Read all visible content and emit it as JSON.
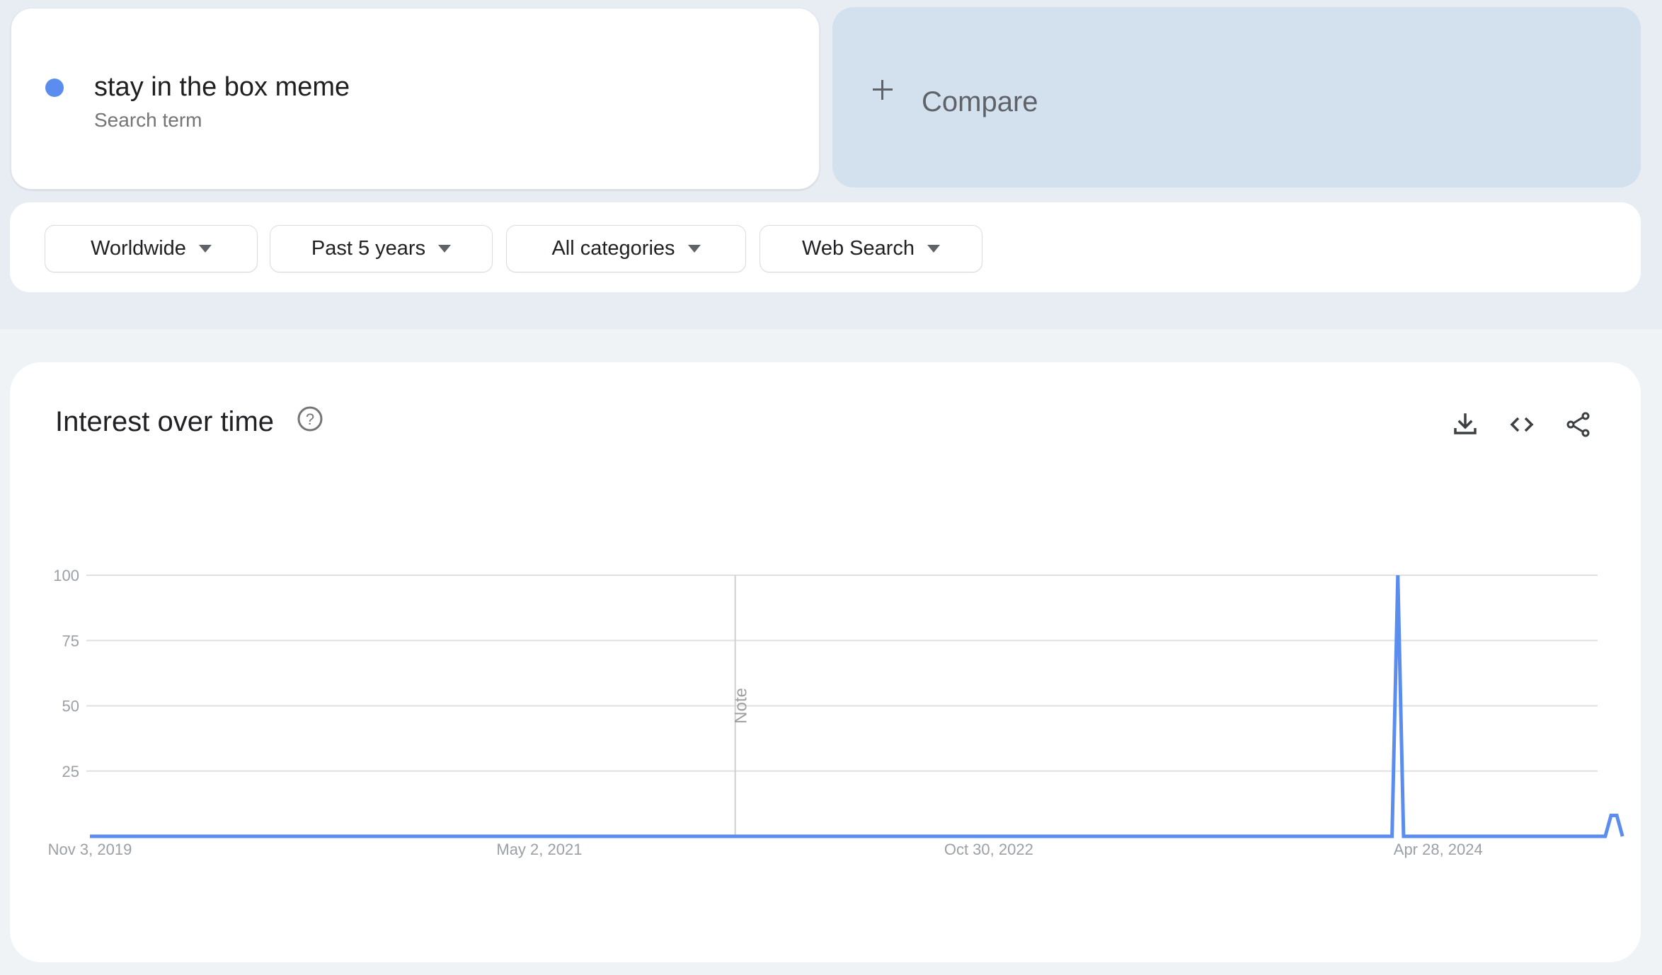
{
  "term_card": {
    "term": "stay in the box meme",
    "subtitle": "Search term",
    "color": "#5b8def"
  },
  "compare": {
    "label": "Compare",
    "icon": "plus-icon"
  },
  "filters": [
    {
      "label": "Worldwide",
      "icon": "caret-down-icon"
    },
    {
      "label": "Past 5 years",
      "icon": "caret-down-icon"
    },
    {
      "label": "All categories",
      "icon": "caret-down-icon"
    },
    {
      "label": "Web Search",
      "icon": "caret-down-icon"
    }
  ],
  "chart_card": {
    "title": "Interest over time",
    "help_icon": "help-circle-icon",
    "tools": [
      {
        "name": "download-icon",
        "label": "Download CSV"
      },
      {
        "name": "embed-icon",
        "label": "Embed"
      },
      {
        "name": "share-icon",
        "label": "Share"
      }
    ]
  },
  "chart_data": {
    "type": "line",
    "title": "Interest over time",
    "xlabel": "",
    "ylabel": "",
    "ylim": [
      0,
      100
    ],
    "yticks": [
      25,
      50,
      75,
      100
    ],
    "ytick_labels": [
      "25",
      "50",
      "75",
      "100"
    ],
    "xtick_labels": [
      "Nov 3, 2019",
      "May 2, 2021",
      "Oct 30, 2022",
      "Apr 28, 2024"
    ],
    "xtick_index": [
      0,
      78,
      156,
      234
    ],
    "interval": "weekly",
    "start": "Nov 3, 2019",
    "grid": true,
    "annotations": [
      {
        "label": "Note",
        "index": 112
      }
    ],
    "series": [
      {
        "name": "stay in the box meme",
        "color": "#5b8def",
        "values": [
          0,
          0,
          0,
          0,
          0,
          0,
          0,
          0,
          0,
          0,
          0,
          0,
          0,
          0,
          0,
          0,
          0,
          0,
          0,
          0,
          0,
          0,
          0,
          0,
          0,
          0,
          0,
          0,
          0,
          0,
          0,
          0,
          0,
          0,
          0,
          0,
          0,
          0,
          0,
          0,
          0,
          0,
          0,
          0,
          0,
          0,
          0,
          0,
          0,
          0,
          0,
          0,
          0,
          0,
          0,
          0,
          0,
          0,
          0,
          0,
          0,
          0,
          0,
          0,
          0,
          0,
          0,
          0,
          0,
          0,
          0,
          0,
          0,
          0,
          0,
          0,
          0,
          0,
          0,
          0,
          0,
          0,
          0,
          0,
          0,
          0,
          0,
          0,
          0,
          0,
          0,
          0,
          0,
          0,
          0,
          0,
          0,
          0,
          0,
          0,
          0,
          0,
          0,
          0,
          0,
          0,
          0,
          0,
          0,
          0,
          0,
          0,
          0,
          0,
          0,
          0,
          0,
          0,
          0,
          0,
          0,
          0,
          0,
          0,
          0,
          0,
          0,
          0,
          0,
          0,
          0,
          0,
          0,
          0,
          0,
          0,
          0,
          0,
          0,
          0,
          0,
          0,
          0,
          0,
          0,
          0,
          0,
          0,
          0,
          0,
          0,
          0,
          0,
          0,
          0,
          0,
          0,
          0,
          0,
          0,
          0,
          0,
          0,
          0,
          0,
          0,
          0,
          0,
          0,
          0,
          0,
          0,
          0,
          0,
          0,
          0,
          0,
          0,
          0,
          0,
          0,
          0,
          0,
          0,
          0,
          0,
          0,
          0,
          0,
          0,
          0,
          0,
          0,
          0,
          0,
          0,
          0,
          0,
          0,
          0,
          0,
          0,
          0,
          0,
          0,
          0,
          0,
          0,
          0,
          0,
          0,
          0,
          0,
          0,
          0,
          0,
          0,
          0,
          0,
          0,
          0,
          0,
          0,
          0,
          0,
          0,
          0,
          100,
          0,
          0,
          0,
          0,
          0,
          0,
          0,
          0,
          0,
          0,
          0,
          0,
          0,
          0,
          0,
          0,
          0,
          0,
          0,
          0,
          0,
          0,
          0,
          0,
          0,
          0,
          0,
          0,
          0,
          0,
          0,
          0,
          0,
          0,
          0,
          0,
          8,
          8,
          0
        ]
      }
    ]
  }
}
